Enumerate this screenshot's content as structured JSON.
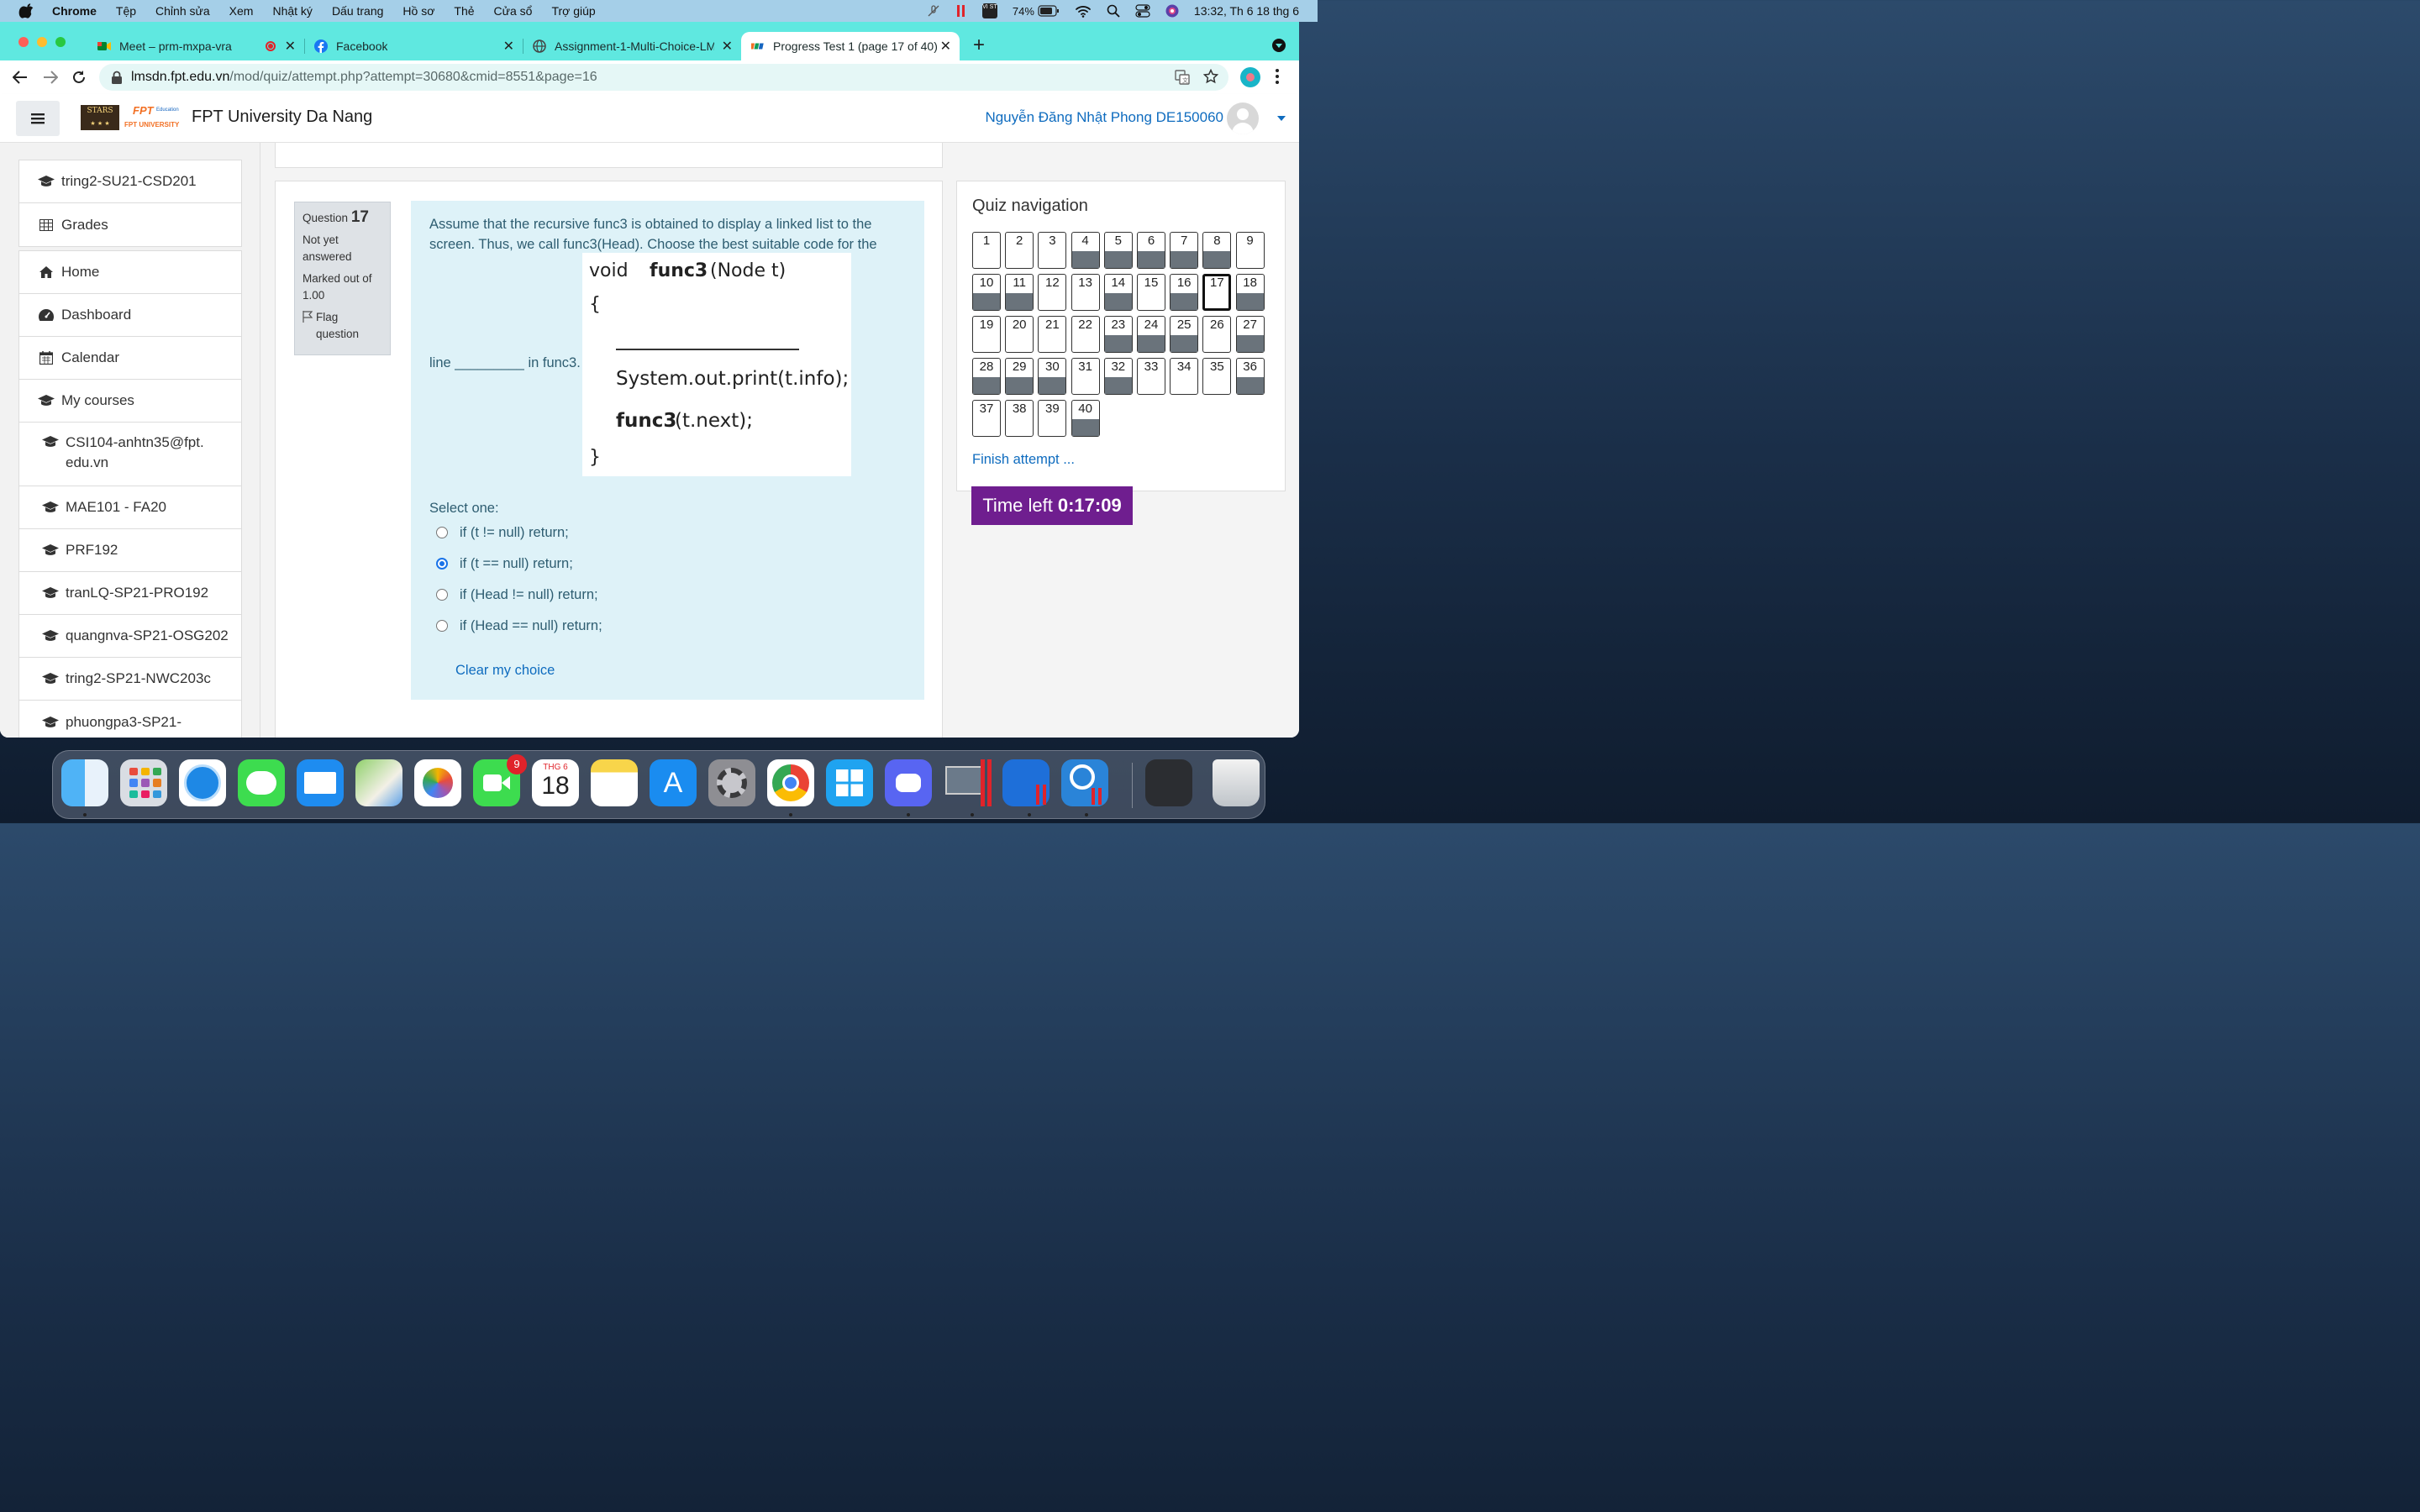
{
  "menubar": {
    "app": "Chrome",
    "items": [
      "Tệp",
      "Chỉnh sửa",
      "Xem",
      "Nhật ký",
      "Dấu trang",
      "Hồ sơ",
      "Thẻ",
      "Cửa sổ",
      "Trợ giúp"
    ],
    "battery": "74%",
    "input_method": "VI ST",
    "clock": "13:32, Th 6 18 thg 6"
  },
  "tabs": [
    {
      "title": "Meet – prm-mxpa-vra"
    },
    {
      "title": "Facebook"
    },
    {
      "title": "Assignment-1-Multi-Choice-LM"
    },
    {
      "title": "Progress Test 1 (page 17 of 40)"
    }
  ],
  "address": {
    "host": "lmsdn.fpt.edu.vn",
    "path": "/mod/quiz/attempt.php?attempt=30680&cmid=8551&page=16"
  },
  "site": {
    "logo_stars": "STARS",
    "logo_fpt": "FPT",
    "logo_education": "Education",
    "logo_university": "FPT UNIVERSITY",
    "title": "FPT University Da Nang",
    "user": "Nguyễn Đăng Nhật Phong DE150060"
  },
  "drawer": {
    "top": [
      "tring2-SU21-CSD201",
      "Grades"
    ],
    "main": [
      "Home",
      "Dashboard",
      "Calendar",
      "My courses"
    ],
    "courses": [
      "CSI104-anhtn35@fpt.edu.vn",
      "MAE101 - FA20",
      "PRF192",
      "tranLQ-SP21-PRO192",
      "quangnva-SP21-OSG202",
      "tring2-SP21-NWC203c",
      "phuongpa3-SP21-"
    ]
  },
  "question": {
    "label": "Question",
    "number": "17",
    "state": "Not yet answered",
    "mark": "Marked out of 1.00",
    "flag": "Flag question",
    "text": "Assume that the recursive func3 is obtained to display a linked list to the screen. Thus, we call func3(Head). Choose the best suitable code for the",
    "text_after": "line _________ in func3.",
    "code": {
      "l1a": "void",
      "l1b": "func3",
      "l1c": "(Node  t)",
      "l2": "{",
      "l4": "System.out.print(t.info);",
      "l5a": "func3",
      "l5b": "(t.next);",
      "l6": "}"
    },
    "select_one": "Select one:",
    "options": [
      {
        "text": "if (t != null) return;",
        "selected": false
      },
      {
        "text": "if (t == null) return;",
        "selected": true
      },
      {
        "text": "if (Head != null) return;",
        "selected": false
      },
      {
        "text": "if (Head == null) return;",
        "selected": false
      }
    ],
    "clear": "Clear my choice"
  },
  "quiz_nav": {
    "title": "Quiz navigation",
    "current": 17,
    "answered": [
      4,
      5,
      6,
      7,
      8,
      10,
      11,
      14,
      16,
      18,
      23,
      24,
      25,
      27,
      28,
      29,
      30,
      32,
      36,
      40
    ],
    "finish": "Finish attempt ..."
  },
  "timer": {
    "label": "Time left",
    "value": "0:17:09"
  },
  "dock": {
    "calendar_month": "THG 6",
    "calendar_day": "18",
    "messages_badge": "9"
  },
  "colors": {
    "accent": "#0f6cbf",
    "timer_bg": "#6f1e8f",
    "question_bg": "#def2f8",
    "tabstrip": "#5fe8e0"
  }
}
